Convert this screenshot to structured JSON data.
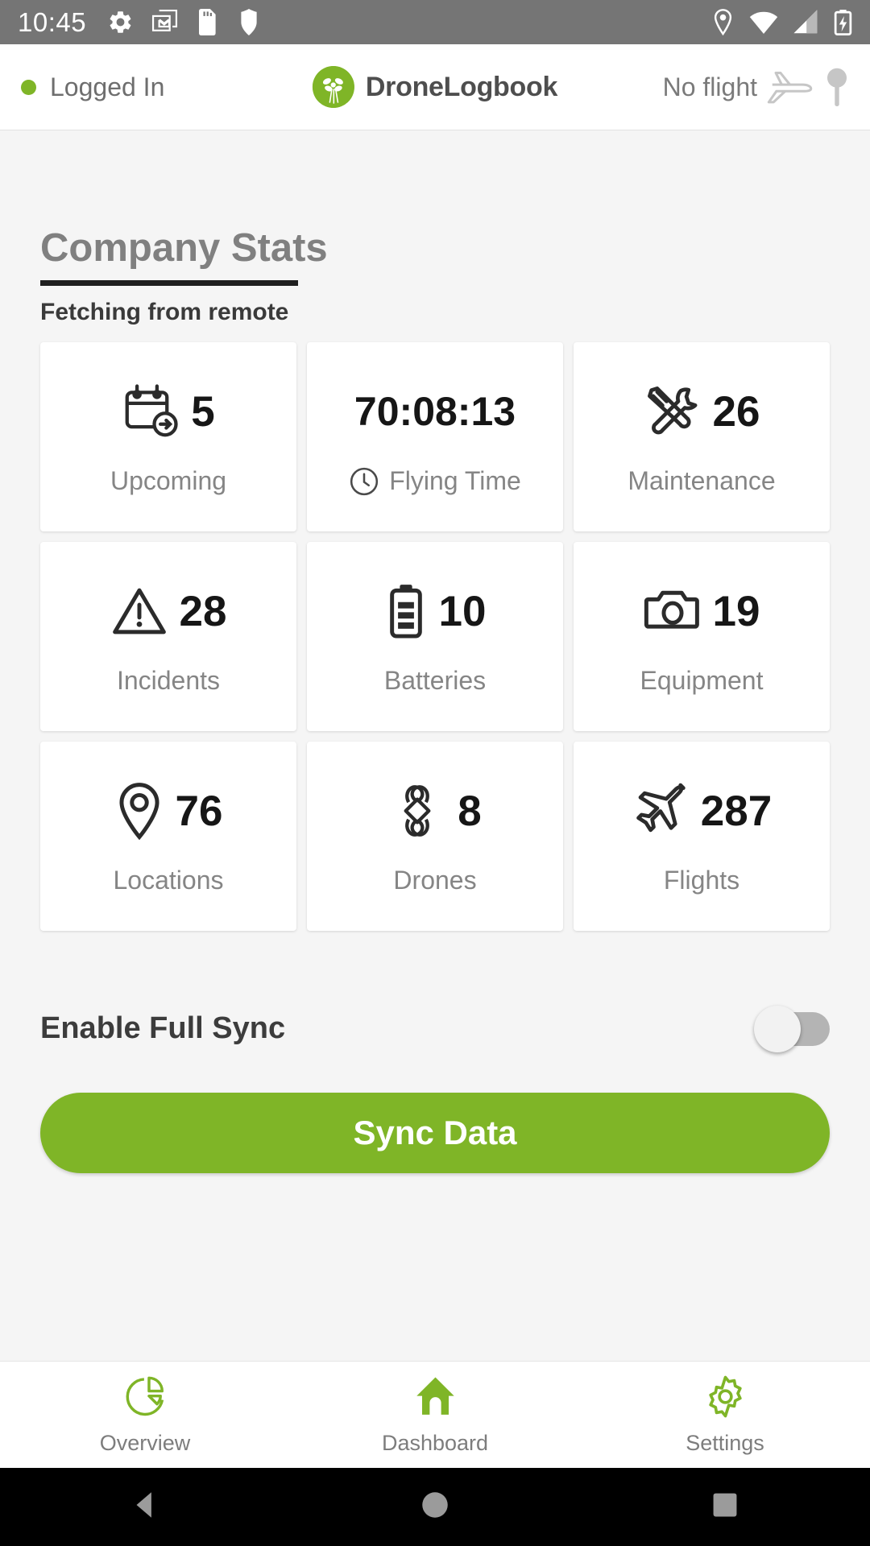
{
  "status_bar": {
    "time": "10:45",
    "left_icons": [
      "gear-icon",
      "gmail-icon",
      "sd-card-icon",
      "shield-icon"
    ],
    "right_icons": [
      "location-icon",
      "wifi-icon",
      "cellular-signal-icon",
      "battery-charging-icon"
    ]
  },
  "header": {
    "login_status": "Logged In",
    "login_dot_color": "#7fb527",
    "brand_name": "DroneLogbook",
    "brand_color": "#7fb527",
    "flight_status": "No flight"
  },
  "main": {
    "page_title": "Company Stats",
    "fetch_status": "Fetching from remote",
    "stats": [
      {
        "icon": "calendar-upcoming-icon",
        "value": "5",
        "label": "Upcoming",
        "icon_position": "left"
      },
      {
        "icon": "clock-icon",
        "value": "70:08:13",
        "label": "Flying Time",
        "icon_position": "label"
      },
      {
        "icon": "tools-icon",
        "value": "26",
        "label": "Maintenance",
        "icon_position": "left"
      },
      {
        "icon": "warning-triangle-icon",
        "value": "28",
        "label": "Incidents",
        "icon_position": "left"
      },
      {
        "icon": "battery-icon",
        "value": "10",
        "label": "Batteries",
        "icon_position": "left"
      },
      {
        "icon": "camera-icon",
        "value": "19",
        "label": "Equipment",
        "icon_position": "left"
      },
      {
        "icon": "map-pin-icon",
        "value": "76",
        "label": "Locations",
        "icon_position": "left"
      },
      {
        "icon": "quadcopter-icon",
        "value": "8",
        "label": "Drones",
        "icon_position": "left"
      },
      {
        "icon": "airplane-icon",
        "value": "287",
        "label": "Flights",
        "icon_position": "left"
      }
    ],
    "full_sync_label": "Enable Full Sync",
    "full_sync_enabled": "off",
    "sync_button_label": "Sync Data",
    "sync_button_color": "#7fb527"
  },
  "tab_bar": {
    "active": "Dashboard",
    "accent_color": "#7fb527",
    "tabs": [
      {
        "icon": "pie-chart-icon",
        "label": "Overview"
      },
      {
        "icon": "home-icon",
        "label": "Dashboard"
      },
      {
        "icon": "gear-icon",
        "label": "Settings"
      }
    ]
  },
  "nav_bar": {
    "buttons": [
      "back-triangle-icon",
      "home-circle-icon",
      "recents-square-icon"
    ]
  }
}
